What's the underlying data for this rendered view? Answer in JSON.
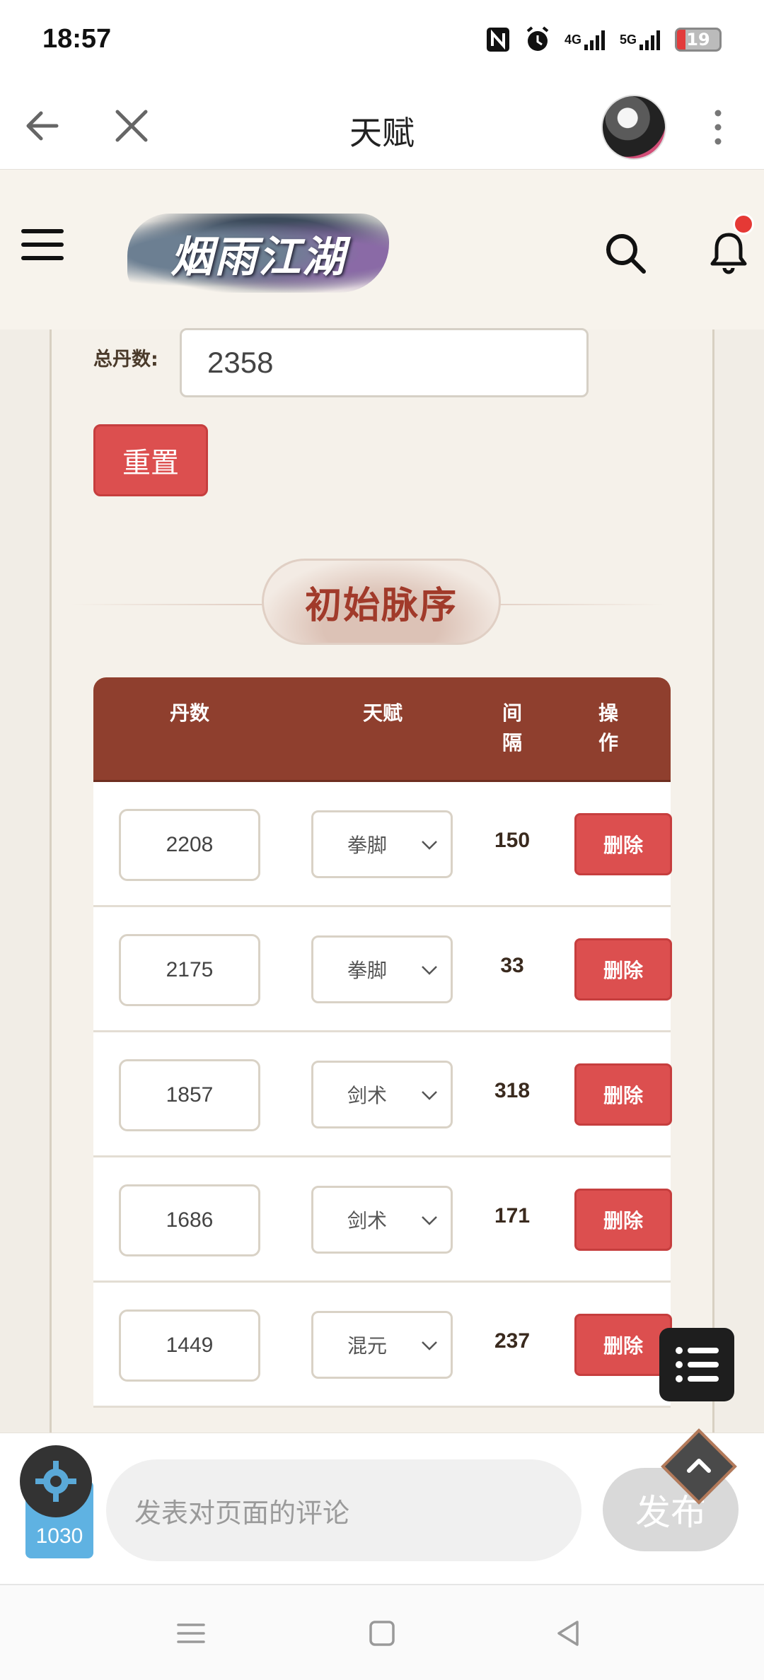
{
  "status": {
    "time": "18:57",
    "battery": "19",
    "net1": "4G",
    "net2": "5G"
  },
  "titlebar": {
    "title": "天赋"
  },
  "site": {
    "logo_text": "烟雨江湖"
  },
  "form": {
    "total_label": "总丹数:",
    "total_value": "2358",
    "reset_label": "重置"
  },
  "section": {
    "title": "初始脉序"
  },
  "table": {
    "headers": {
      "dan": "丹数",
      "talent": "天赋",
      "interval": "间\n隔",
      "op": "操\n作"
    },
    "delete_label": "删除",
    "rows": [
      {
        "dan": "2208",
        "talent": "拳脚",
        "interval": "150"
      },
      {
        "dan": "2175",
        "talent": "拳脚",
        "interval": "33"
      },
      {
        "dan": "1857",
        "talent": "剑术",
        "interval": "318"
      },
      {
        "dan": "1686",
        "talent": "剑术",
        "interval": "171"
      },
      {
        "dan": "1449",
        "talent": "混元",
        "interval": "237"
      }
    ]
  },
  "comment": {
    "placeholder": "发表对页面的评论",
    "publish": "发布",
    "widget_count": "1030"
  },
  "icons": [
    "back-arrow-icon",
    "close-icon",
    "more-icon",
    "menu-icon",
    "search-icon",
    "bell-icon",
    "chevron-down-icon",
    "list-icon",
    "gear-icon",
    "chevron-up-icon"
  ],
  "colors": {
    "accent_red": "#dc4f4f",
    "header_brown": "#8f3f2e",
    "title_red": "#a13a2a"
  }
}
